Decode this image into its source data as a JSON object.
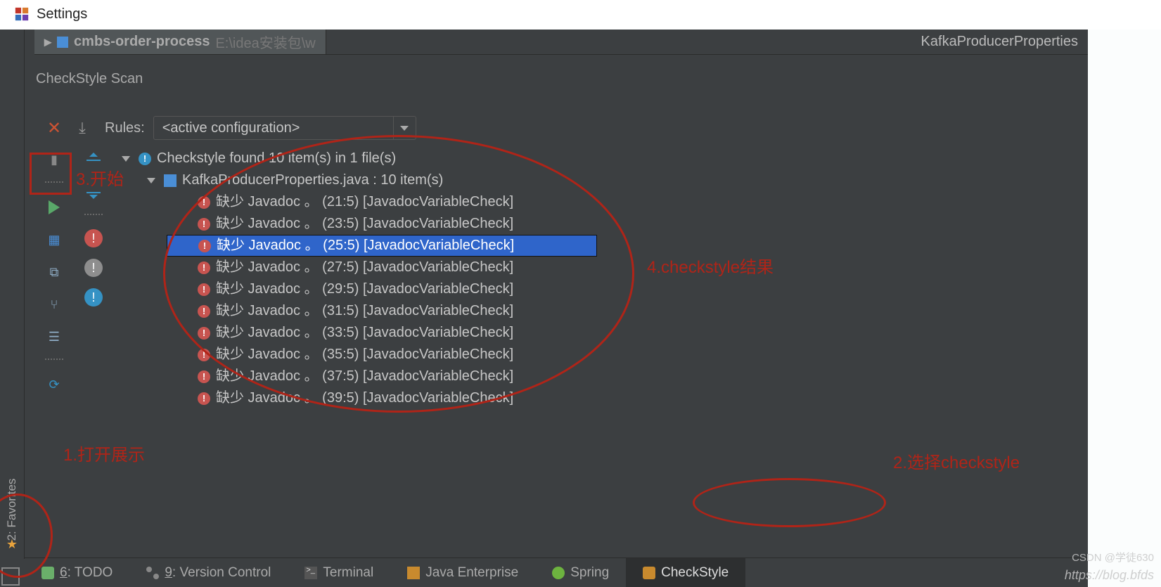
{
  "window": {
    "title": "Settings"
  },
  "tabs": {
    "project_name": "cmbs-order-process",
    "project_path": "E:\\idea安装包\\w",
    "editor_title": "KafkaProducerProperties"
  },
  "panel": {
    "title": "CheckStyle Scan"
  },
  "rules": {
    "label": "Rules:",
    "selected": "<active configuration>"
  },
  "tree": {
    "root": "Checkstyle found 10 item(s) in 1 file(s)",
    "file": "KafkaProducerProperties.java : 10 item(s)",
    "items": [
      {
        "text": "缺少 Javadoc 。 (21:5) [JavadocVariableCheck]",
        "selected": false
      },
      {
        "text": "缺少 Javadoc 。 (23:5) [JavadocVariableCheck]",
        "selected": false
      },
      {
        "text": "缺少 Javadoc 。 (25:5) [JavadocVariableCheck]",
        "selected": true
      },
      {
        "text": "缺少 Javadoc 。 (27:5) [JavadocVariableCheck]",
        "selected": false
      },
      {
        "text": "缺少 Javadoc 。 (29:5) [JavadocVariableCheck]",
        "selected": false
      },
      {
        "text": "缺少 Javadoc 。 (31:5) [JavadocVariableCheck]",
        "selected": false
      },
      {
        "text": "缺少 Javadoc 。 (33:5) [JavadocVariableCheck]",
        "selected": false
      },
      {
        "text": "缺少 Javadoc 。 (35:5) [JavadocVariableCheck]",
        "selected": false
      },
      {
        "text": "缺少 Javadoc 。 (37:5) [JavadocVariableCheck]",
        "selected": false
      },
      {
        "text": "缺少 Javadoc 。 (39:5) [JavadocVariableCheck]",
        "selected": false
      }
    ]
  },
  "side": {
    "favorites": "2: Favorites"
  },
  "status": {
    "todo": {
      "num": "6",
      "rest": ": TODO"
    },
    "vc": {
      "num": "9",
      "rest": ": Version Control"
    },
    "terminal": "Terminal",
    "je": "Java Enterprise",
    "spring": "Spring",
    "checkstyle": "CheckStyle"
  },
  "annotations": {
    "a1": "1.打开展示",
    "a2": "2.选择checkstyle",
    "a3": "3.开始",
    "a4": "4.checkstyle结果"
  },
  "watermark": {
    "small": "CSDN @学徒630",
    "url": "https://blog.bfds"
  }
}
